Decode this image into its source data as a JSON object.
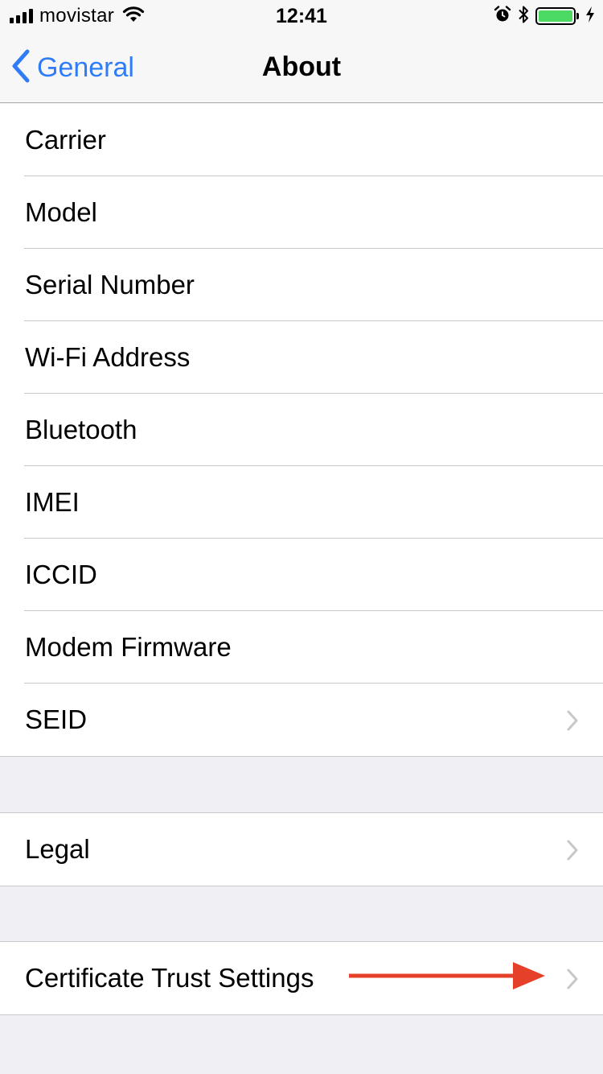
{
  "status_bar": {
    "carrier": "movistar",
    "time": "12:41",
    "battery_level": 1.0,
    "icons": [
      "signal-icon",
      "wifi-icon",
      "alarm-icon",
      "bluetooth-icon",
      "battery-icon",
      "charging-icon"
    ]
  },
  "nav": {
    "back_label": "General",
    "title": "About"
  },
  "groups": {
    "info": [
      {
        "label": "Carrier"
      },
      {
        "label": "Model"
      },
      {
        "label": "Serial Number"
      },
      {
        "label": "Wi-Fi Address"
      },
      {
        "label": "Bluetooth"
      },
      {
        "label": "IMEI"
      },
      {
        "label": "ICCID"
      },
      {
        "label": "Modem Firmware"
      },
      {
        "label": "SEID"
      }
    ],
    "legal": [
      {
        "label": "Legal"
      }
    ],
    "certs": [
      {
        "label": "Certificate Trust Settings"
      }
    ]
  },
  "colors": {
    "accent": "#2f7cf6",
    "annotation_arrow": "#e5402a",
    "battery": "#4cd964"
  }
}
